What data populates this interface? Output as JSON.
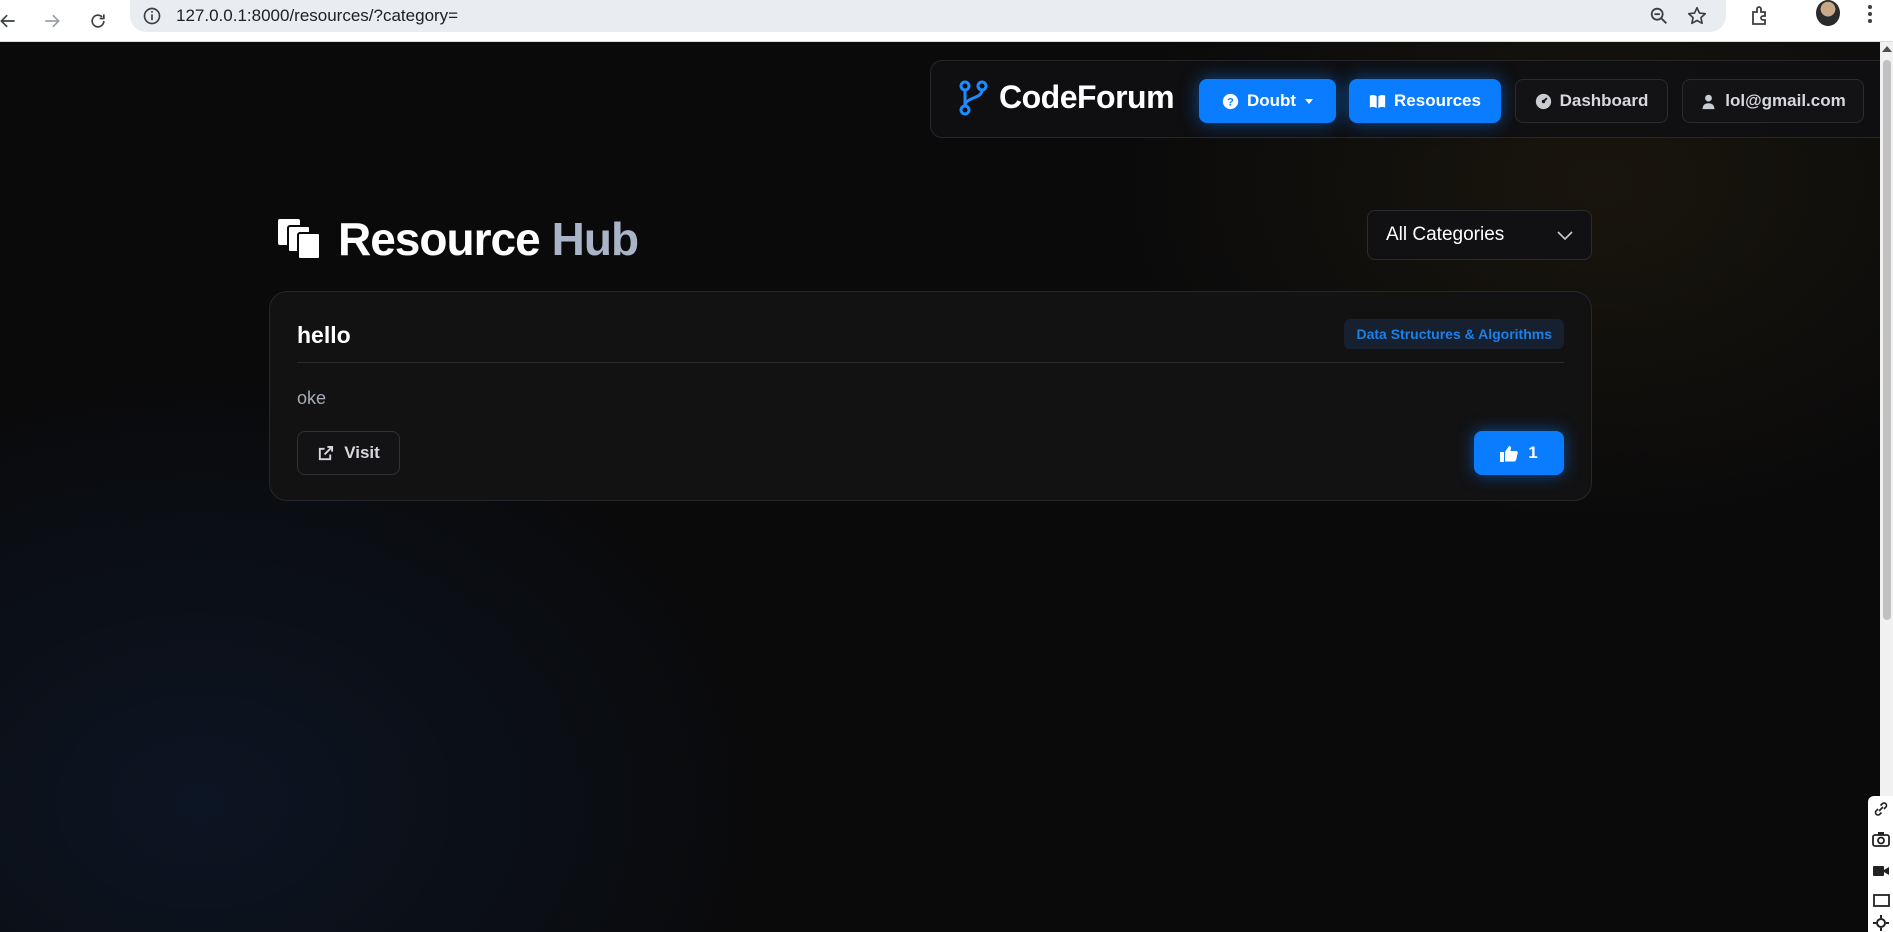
{
  "browser": {
    "url": "127.0.0.1:8000/resources/?category="
  },
  "navbar": {
    "brand": "CodeForum",
    "items": [
      {
        "label": "Doubt",
        "icon": "question-circle-icon",
        "style": "primary",
        "dropdown": true
      },
      {
        "label": "Resources",
        "icon": "book-open-icon",
        "style": "primary"
      },
      {
        "label": "Dashboard",
        "icon": "gauge-icon",
        "style": "outline"
      },
      {
        "label": "lol@gmail.com",
        "icon": "user-icon",
        "style": "outline"
      }
    ]
  },
  "header": {
    "title_part1": "Resource",
    "title_part2": "Hub",
    "icon": "copy-stack-icon"
  },
  "filter": {
    "selected": "All Categories"
  },
  "resources": [
    {
      "title": "hello",
      "category": "Data Structures & Algorithms",
      "description": "oke",
      "visit_label": "Visit",
      "likes": "1"
    }
  ],
  "colors": {
    "accent": "#0a7cff",
    "background": "#0a0a0b",
    "card": "#121213",
    "tag_text": "#1d7fe8",
    "title_muted": "#a9b4c6"
  }
}
